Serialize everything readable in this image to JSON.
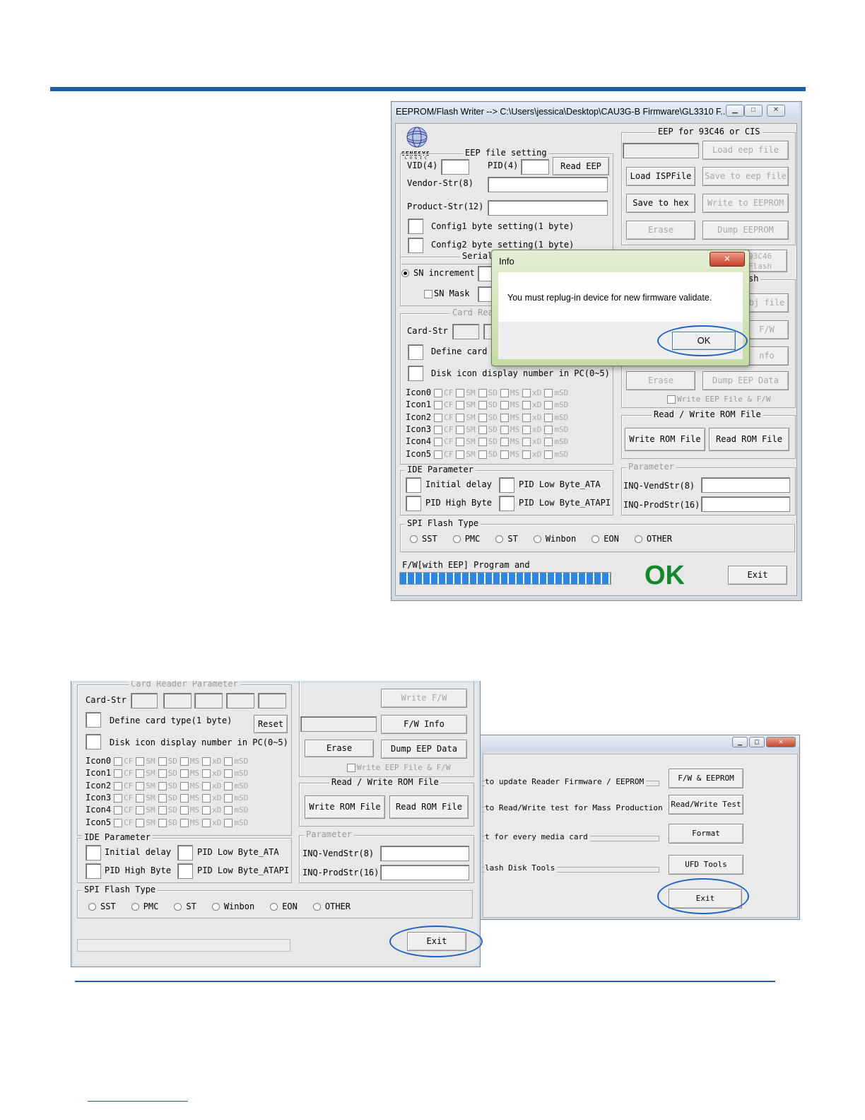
{
  "colors": {
    "accent": "#1f5fa6",
    "ok_green": "#13882b",
    "progress_blue": "#2f86e3",
    "highlight_ellipse": "#1f63c6"
  },
  "main_window": {
    "title": "EEPROM/Flash Writer --> C:\\Users\\jessica\\Desktop\\CAU3G-B Firmware\\GL3310 F...",
    "logo_text": "GENESYS",
    "logo_subtext": "LOGIC",
    "eep_file_setting": {
      "title": "EEP file setting",
      "vid_label": "VID(4)",
      "pid_label": "PID(4)",
      "read_eep_button": "Read EEP",
      "vendor_str_label": "Vendor-Str(8)",
      "product_str_label": "Product-Str(12)",
      "config1_label": "Config1 byte setting(1 byte)",
      "config2_label": "Config2 byte setting(1 byte)"
    },
    "serial": {
      "title_partial": "Serial",
      "sn_increment": "SN increment",
      "sn_mask": "SN Mask"
    },
    "card_reader": {
      "title_partial": "Card Rea",
      "card_str_label": "Card-Str",
      "define_card_partial": "Define card",
      "disk_icon_label": "Disk icon display number in PC(0~5)"
    },
    "icons": {
      "names": [
        "Icon0",
        "Icon1",
        "Icon2",
        "Icon3",
        "Icon4",
        "Icon5"
      ],
      "options": [
        "CF",
        "SM",
        "SD",
        "MS",
        "xD",
        "mSD"
      ]
    },
    "ide_parameter": {
      "title": "IDE Parameter",
      "initial_delay": "Initial delay",
      "pid_low_ata": "PID Low Byte_ATA",
      "pid_high": "PID High Byte",
      "pid_low_atapi": "PID Low Byte_ATAPI"
    },
    "spi_flash": {
      "title": "SPI Flash Type",
      "options": [
        "SST",
        "PMC",
        "ST",
        "Winbon",
        "EON",
        "OTHER"
      ]
    },
    "eep_93c46": {
      "title": "EEP for 93C46 or CIS",
      "load_eep_file": "Load eep file",
      "load_ispfile": "Load ISPFile",
      "save_to_eep_file": "Save to eep file",
      "save_to_hex": "Save to hex",
      "write_to_eeprom": "Write to EEPROM",
      "erase": "Erase",
      "dump_eeprom": "Dump EEPROM"
    },
    "right_partial": {
      "c46": "93C46",
      "flash": "Flash",
      "sh": "sh",
      "bj_file": "bj file",
      "fw": "F/W",
      "nfo": "nfo",
      "erase": "Erase",
      "dump_eep_data": "Dump EEP Data",
      "write_eep_file_fw": "Write EEP File & F/W"
    },
    "rom_file": {
      "title": "Read / Write ROM File",
      "write": "Write ROM File",
      "read": "Read ROM File"
    },
    "parameter": {
      "title": "Parameter",
      "inq_vend": "INQ-VendStr(8)",
      "inq_prod": "INQ-ProdStr(16)"
    },
    "status": {
      "text": "F/W[with EEP] Program and",
      "ok": "OK",
      "progress": 1.0
    },
    "exit_button": "Exit"
  },
  "info_dialog": {
    "title": "Info",
    "message": "You must replug-in device for new firmware validate.",
    "ok_button": "OK"
  },
  "lower_left": {
    "card_reader": {
      "title": "Card Reader Parameter",
      "card_str_label": "Card-Str",
      "define_card_type": "Define card type(1 byte)",
      "reset_button": "Reset",
      "disk_icon_label": "Disk icon display number in PC(0~5)"
    },
    "right_col": {
      "write_fw": "Write F/W",
      "fw_info": "F/W Info",
      "erase": "Erase",
      "dump_eep_data": "Dump EEP Data",
      "write_eep_file_fw": "Write EEP File & F/W"
    },
    "exit_button": "Exit"
  },
  "lower_right": {
    "rows": [
      {
        "text": "to update Reader Firmware / EEPROM",
        "button": "F/W & EEPROM"
      },
      {
        "text": "to Read/Write test for Mass Production",
        "button": "Read/Write Test"
      },
      {
        "text": "t for every media card",
        "button": "Format"
      },
      {
        "text": "lash Disk Tools",
        "button": "UFD Tools"
      }
    ],
    "exit_button": "Exit"
  }
}
